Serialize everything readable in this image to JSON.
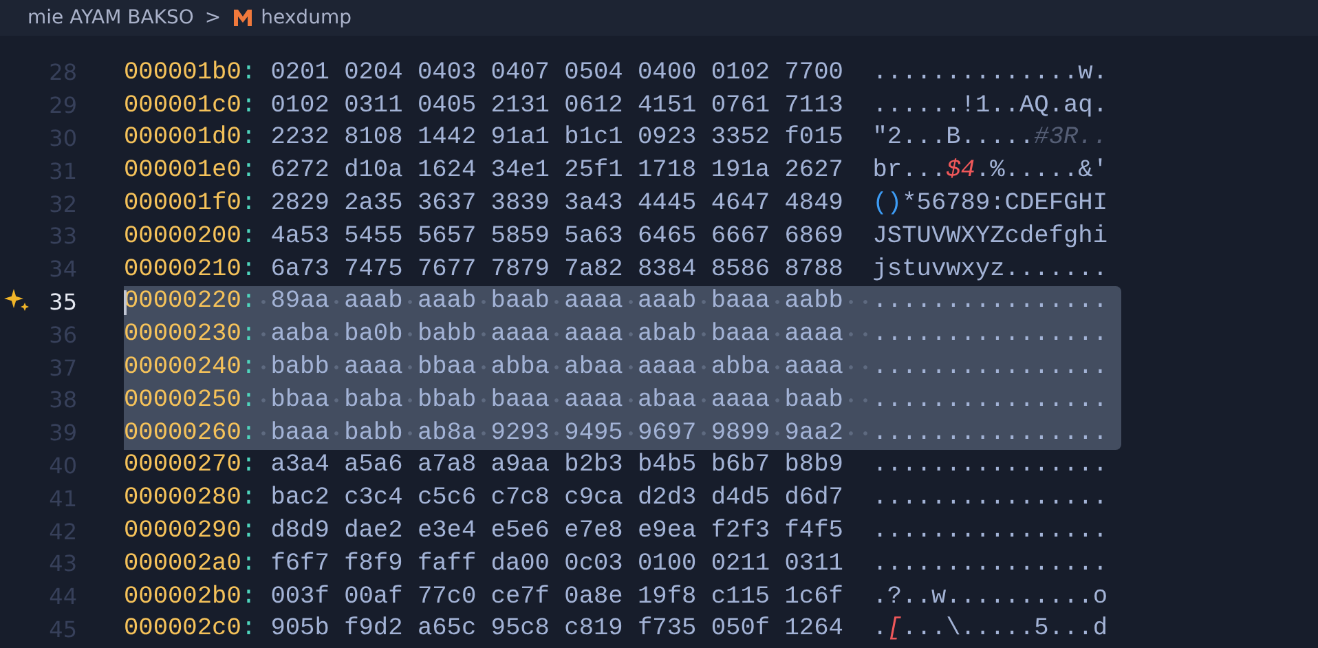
{
  "breadcrumb": {
    "folder": "mie AYAM BAKSO",
    "separator": ">",
    "file": "hexdump"
  },
  "rows": [
    {
      "line": "28",
      "address": "000001b0",
      "colon": ":",
      "hex": [
        "0201",
        "0204",
        "0403",
        "0407",
        "0504",
        "0400",
        "0102",
        "7700"
      ],
      "ascii": [
        {
          "text": "..............w.",
          "kind": "plain"
        }
      ],
      "selected": false,
      "current": false
    },
    {
      "line": "29",
      "address": "000001c0",
      "colon": ":",
      "hex": [
        "0102",
        "0311",
        "0405",
        "2131",
        "0612",
        "4151",
        "0761",
        "7113"
      ],
      "ascii": [
        {
          "text": "......!1..AQ.aq.",
          "kind": "plain"
        }
      ],
      "selected": false,
      "current": false
    },
    {
      "line": "30",
      "address": "000001d0",
      "colon": ":",
      "hex": [
        "2232",
        "8108",
        "1442",
        "91a1",
        "b1c1",
        "0923",
        "3352",
        "f015"
      ],
      "ascii": [
        {
          "text": "\"2...B.....",
          "kind": "plain"
        },
        {
          "text": "#3R..",
          "kind": "comment"
        }
      ],
      "selected": false,
      "current": false
    },
    {
      "line": "31",
      "address": "000001e0",
      "colon": ":",
      "hex": [
        "6272",
        "d10a",
        "1624",
        "34e1",
        "25f1",
        "1718",
        "191a",
        "2627"
      ],
      "ascii": [
        {
          "text": "br...",
          "kind": "plain"
        },
        {
          "text": "$4",
          "kind": "error"
        },
        {
          "text": ".%.....&'",
          "kind": "plain"
        }
      ],
      "selected": false,
      "current": false
    },
    {
      "line": "32",
      "address": "000001f0",
      "colon": ":",
      "hex": [
        "2829",
        "2a35",
        "3637",
        "3839",
        "3a43",
        "4445",
        "4647",
        "4849"
      ],
      "ascii": [
        {
          "text": "()",
          "kind": "bracket"
        },
        {
          "text": "*56789:CDEFGHI",
          "kind": "plain"
        }
      ],
      "selected": false,
      "current": false
    },
    {
      "line": "33",
      "address": "00000200",
      "colon": ":",
      "hex": [
        "4a53",
        "5455",
        "5657",
        "5859",
        "5a63",
        "6465",
        "6667",
        "6869"
      ],
      "ascii": [
        {
          "text": "JSTUVWXYZcdefghi",
          "kind": "plain"
        }
      ],
      "selected": false,
      "current": false
    },
    {
      "line": "34",
      "address": "00000210",
      "colon": ":",
      "hex": [
        "6a73",
        "7475",
        "7677",
        "7879",
        "7a82",
        "8384",
        "8586",
        "8788"
      ],
      "ascii": [
        {
          "text": "jstuvwxyz.......",
          "kind": "plain"
        }
      ],
      "selected": false,
      "current": false
    },
    {
      "line": "35",
      "address": "00000220",
      "colon": ":",
      "hex": [
        "89aa",
        "aaab",
        "aaab",
        "baab",
        "aaaa",
        "aaab",
        "baaa",
        "aabb"
      ],
      "ascii": [
        {
          "text": "................",
          "kind": "plain"
        }
      ],
      "selected": true,
      "current": true
    },
    {
      "line": "36",
      "address": "00000230",
      "colon": ":",
      "hex": [
        "aaba",
        "ba0b",
        "babb",
        "aaaa",
        "aaaa",
        "abab",
        "baaa",
        "aaaa"
      ],
      "ascii": [
        {
          "text": "................",
          "kind": "plain"
        }
      ],
      "selected": true,
      "current": false
    },
    {
      "line": "37",
      "address": "00000240",
      "colon": ":",
      "hex": [
        "babb",
        "aaaa",
        "bbaa",
        "abba",
        "abaa",
        "aaaa",
        "abba",
        "aaaa"
      ],
      "ascii": [
        {
          "text": "................",
          "kind": "plain"
        }
      ],
      "selected": true,
      "current": false
    },
    {
      "line": "38",
      "address": "00000250",
      "colon": ":",
      "hex": [
        "bbaa",
        "baba",
        "bbab",
        "baaa",
        "aaaa",
        "abaa",
        "aaaa",
        "baab"
      ],
      "ascii": [
        {
          "text": "................",
          "kind": "plain"
        }
      ],
      "selected": true,
      "current": false
    },
    {
      "line": "39",
      "address": "00000260",
      "colon": ":",
      "hex": [
        "baaa",
        "babb",
        "ab8a",
        "9293",
        "9495",
        "9697",
        "9899",
        "9aa2"
      ],
      "ascii": [
        {
          "text": "................",
          "kind": "plain"
        }
      ],
      "selected": true,
      "current": false
    },
    {
      "line": "40",
      "address": "00000270",
      "colon": ":",
      "hex": [
        "a3a4",
        "a5a6",
        "a7a8",
        "a9aa",
        "b2b3",
        "b4b5",
        "b6b7",
        "b8b9"
      ],
      "ascii": [
        {
          "text": "................",
          "kind": "plain"
        }
      ],
      "selected": false,
      "current": false
    },
    {
      "line": "41",
      "address": "00000280",
      "colon": ":",
      "hex": [
        "bac2",
        "c3c4",
        "c5c6",
        "c7c8",
        "c9ca",
        "d2d3",
        "d4d5",
        "d6d7"
      ],
      "ascii": [
        {
          "text": "................",
          "kind": "plain"
        }
      ],
      "selected": false,
      "current": false
    },
    {
      "line": "42",
      "address": "00000290",
      "colon": ":",
      "hex": [
        "d8d9",
        "dae2",
        "e3e4",
        "e5e6",
        "e7e8",
        "e9ea",
        "f2f3",
        "f4f5"
      ],
      "ascii": [
        {
          "text": "................",
          "kind": "plain"
        }
      ],
      "selected": false,
      "current": false
    },
    {
      "line": "43",
      "address": "000002a0",
      "colon": ":",
      "hex": [
        "f6f7",
        "f8f9",
        "faff",
        "da00",
        "0c03",
        "0100",
        "0211",
        "0311"
      ],
      "ascii": [
        {
          "text": "................",
          "kind": "plain"
        }
      ],
      "selected": false,
      "current": false
    },
    {
      "line": "44",
      "address": "000002b0",
      "colon": ":",
      "hex": [
        "003f",
        "00af",
        "77c0",
        "ce7f",
        "0a8e",
        "19f8",
        "c115",
        "1c6f"
      ],
      "ascii": [
        {
          "text": ".?..w..........o",
          "kind": "plain"
        }
      ],
      "selected": false,
      "current": false
    },
    {
      "line": "45",
      "address": "000002c0",
      "colon": ":",
      "hex": [
        "905b",
        "f9d2",
        "a65c",
        "95c8",
        "c819",
        "f735",
        "050f",
        "1264"
      ],
      "ascii": [
        {
          "text": ".",
          "kind": "plain"
        },
        {
          "text": "[",
          "kind": "error"
        },
        {
          "text": "...\\.....5...d",
          "kind": "plain"
        }
      ],
      "selected": false,
      "current": false
    }
  ]
}
